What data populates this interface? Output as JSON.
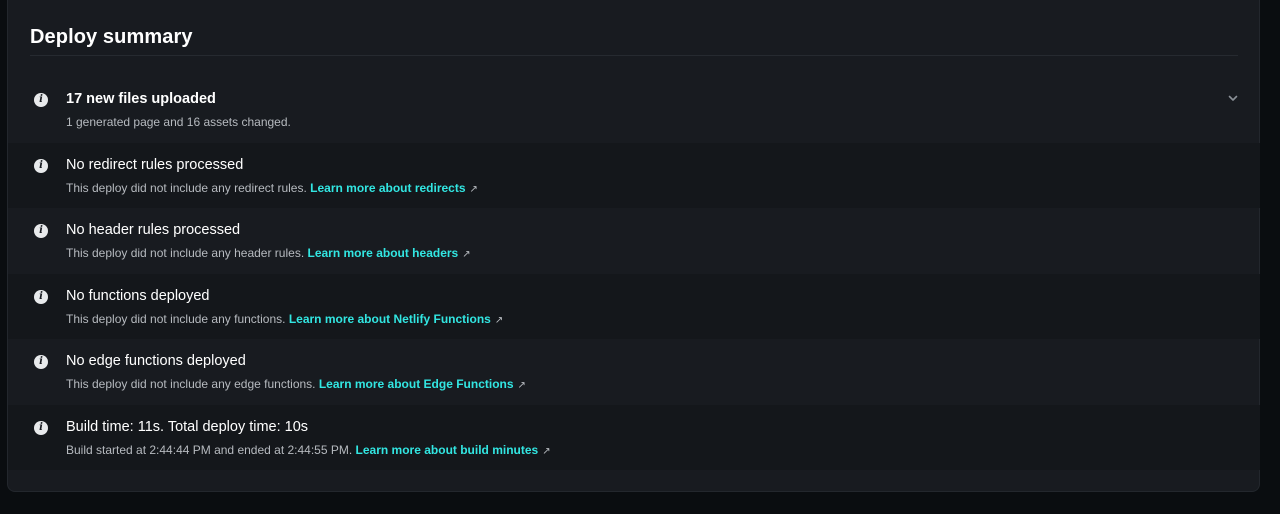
{
  "title": "Deploy summary",
  "items": [
    {
      "title": "17 new files uploaded",
      "description": "1 generated page and 16 assets changed.",
      "link": ""
    },
    {
      "title": "No redirect rules processed",
      "description": "This deploy did not include any redirect rules.",
      "link": "Learn more about redirects"
    },
    {
      "title": "No header rules processed",
      "description": "This deploy did not include any header rules.",
      "link": "Learn more about headers"
    },
    {
      "title": "No functions deployed",
      "description": "This deploy did not include any functions.",
      "link": "Learn more about Netlify Functions"
    },
    {
      "title": "No edge functions deployed",
      "description": "This deploy did not include any edge functions.",
      "link": "Learn more about Edge Functions"
    },
    {
      "title": "Build time: 11s. Total deploy time: 10s",
      "description": "Build started at 2:44:44 PM and ended at 2:44:55 PM.",
      "link": "Learn more about build minutes"
    }
  ],
  "icons": {
    "item": "info-icon",
    "expand": "chevron-down-icon",
    "external": "external-link-icon"
  },
  "colors": {
    "background": "#0a0d10",
    "card": "#181b20",
    "link": "#32e6e2"
  }
}
